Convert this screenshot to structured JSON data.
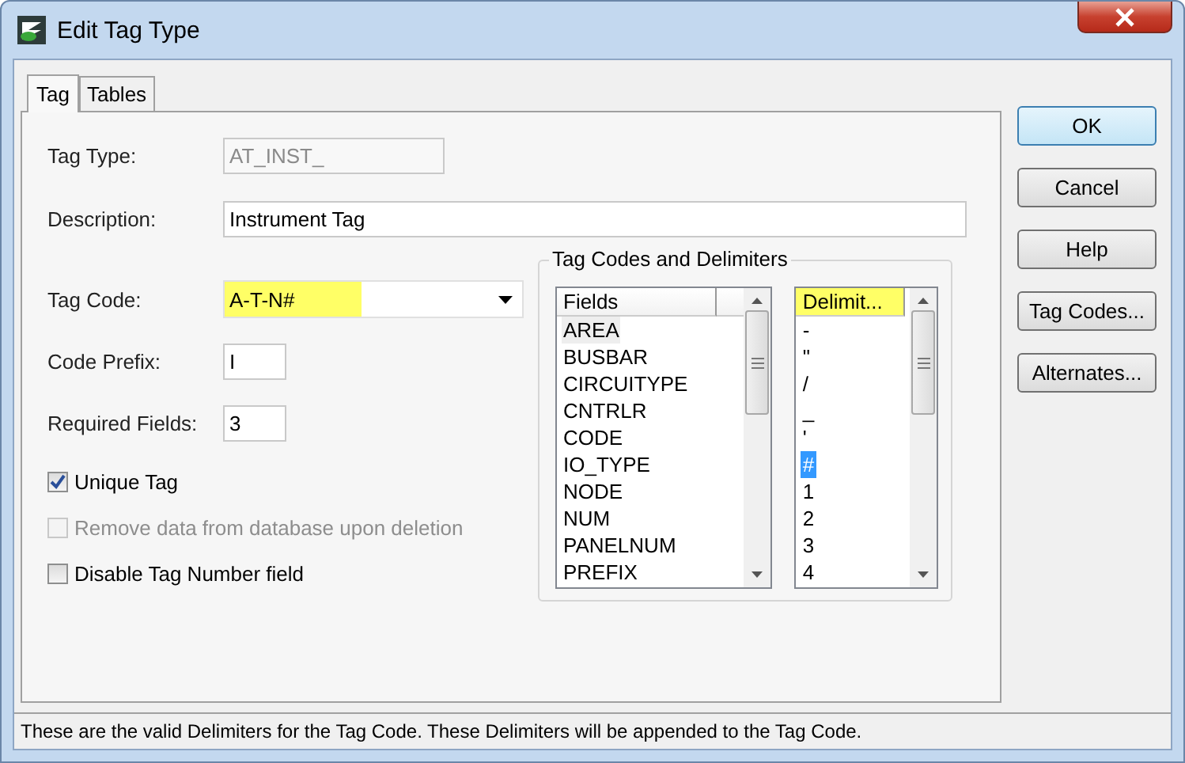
{
  "window": {
    "title": "Edit Tag Type"
  },
  "tabs": [
    {
      "label": "Tag",
      "selected": true
    },
    {
      "label": "Tables",
      "selected": false
    }
  ],
  "form": {
    "tag_type": {
      "label": "Tag Type:",
      "value": "AT_INST_",
      "disabled": true
    },
    "description": {
      "label": "Description:",
      "value": "Instrument Tag"
    },
    "tag_code": {
      "label": "Tag Code:",
      "value": "A-T-N#",
      "highlighted": true
    },
    "code_prefix": {
      "label": "Code Prefix:",
      "value": "I"
    },
    "required_fields": {
      "label": "Required Fields:",
      "value": "3"
    }
  },
  "checkboxes": [
    {
      "label": "Unique Tag",
      "checked": true,
      "disabled": false
    },
    {
      "label": "Remove data from database upon deletion",
      "checked": false,
      "disabled": true
    },
    {
      "label": "Disable Tag Number field",
      "checked": false,
      "disabled": false
    }
  ],
  "group": {
    "title": "Tag Codes and Delimiters",
    "fields": {
      "header": "Fields",
      "highlighted": false,
      "items": [
        {
          "label": "AREA",
          "selected": true
        },
        {
          "label": "BUSBAR",
          "selected": false
        },
        {
          "label": "CIRCUITYPE",
          "selected": false
        },
        {
          "label": "CNTRLR",
          "selected": false
        },
        {
          "label": "CODE",
          "selected": false
        },
        {
          "label": "IO_TYPE",
          "selected": false
        },
        {
          "label": "NODE",
          "selected": false
        },
        {
          "label": "NUM",
          "selected": false
        },
        {
          "label": "PANELNUM",
          "selected": false
        },
        {
          "label": "PREFIX",
          "selected": false
        }
      ]
    },
    "delimiters": {
      "header": "Delimit...",
      "highlighted": true,
      "items": [
        {
          "label": "-",
          "selected": false
        },
        {
          "label": "\"",
          "selected": false
        },
        {
          "label": "/",
          "selected": false
        },
        {
          "label": "_",
          "selected": false
        },
        {
          "label": "'",
          "selected": false
        },
        {
          "label": "#",
          "selected": true
        },
        {
          "label": "1",
          "selected": false
        },
        {
          "label": "2",
          "selected": false
        },
        {
          "label": "3",
          "selected": false
        },
        {
          "label": "4",
          "selected": false
        }
      ]
    }
  },
  "buttons": [
    {
      "label": "OK",
      "default": true
    },
    {
      "label": "Cancel",
      "default": false
    },
    {
      "label": "Help",
      "default": false
    },
    {
      "label": "Tag Codes...",
      "default": false
    },
    {
      "label": "Alternates...",
      "default": false
    }
  ],
  "status_bar": "These are the valid Delimiters for the Tag Code. These Delimiters will be appended to the Tag Code."
}
